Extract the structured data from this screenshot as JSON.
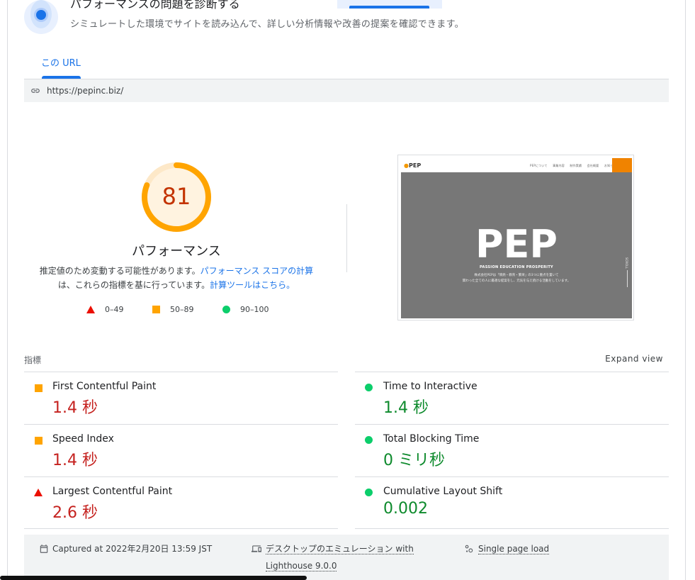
{
  "hero": {
    "title": "パフォーマンスの問題を診断する",
    "subtitle": "シミュレートした環境でサイトを読み込んで、詳しい分析情報や改善の提案を確認できます。"
  },
  "tabs": [
    {
      "label": "この URL",
      "active": true
    }
  ],
  "url": {
    "icon": "link-icon",
    "text": "https://pepinc.biz/"
  },
  "performance": {
    "score": "81",
    "score_fraction": 0.81,
    "score_color": "#ffa400",
    "title": "パフォーマンス",
    "desc_part1": "推定値のため変動する可能性があります。",
    "desc_link1": "パフォーマンス スコアの計算",
    "desc_part2": "は、これらの指標を基に行っています。",
    "desc_link2": "計算ツールはこちら。"
  },
  "legend": [
    {
      "icon": "triangle-icon",
      "label": "0–49",
      "color": "#eb0f00"
    },
    {
      "icon": "square-icon",
      "label": "50–89",
      "color": "#ffa400"
    },
    {
      "icon": "circle-icon",
      "label": "90–100",
      "color": "#0cce6b"
    }
  ],
  "screenshot": {
    "logo": "PEP",
    "nav_links": "PEPについて 事業内容 制作実績 会社概要 お知らせ",
    "hero_title": "PEP",
    "tagline": "PASSION EDUCATION PROSPERITY",
    "body_line1": "株式会社PEPは「情熱・教育・繁栄」の3つに重点を置いて",
    "body_line2": "関わった全ての人に最適な提案をし、元気を与え続ける活動をしています。",
    "scroll": "SCROLL"
  },
  "metrics": {
    "label": "指標",
    "expand": "Expand view",
    "fcp": {
      "title": "First Contentful Paint",
      "value": "1.4 秒",
      "rating": "average"
    },
    "si": {
      "title": "Speed Index",
      "value": "1.4 秒",
      "rating": "average"
    },
    "lcp": {
      "title": "Largest Contentful Paint",
      "value": "2.6 秒",
      "rating": "fail"
    },
    "tti": {
      "title": "Time to Interactive",
      "value": "1.4 秒",
      "rating": "pass"
    },
    "tbt": {
      "title": "Total Blocking Time",
      "value": "0 ミリ秒",
      "rating": "pass"
    },
    "cls": {
      "title": "Cumulative Layout Shift",
      "value": "0.002",
      "rating": "pass"
    }
  },
  "footer": {
    "captured": "Captured at 2022年2月20日 13:59 JST",
    "emulation_line1": "デスクトップのエミュレーション with",
    "emulation_line2": "Lighthouse 9.0.0",
    "load": "Single page load"
  }
}
